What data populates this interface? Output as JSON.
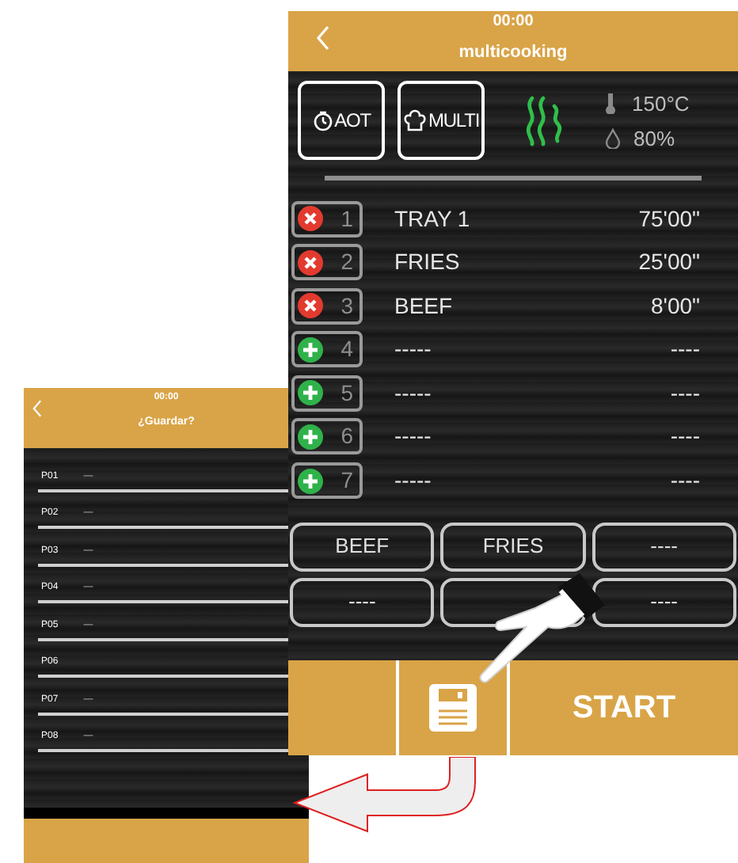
{
  "save_screen": {
    "time": "00:00",
    "title": "¿Guardar?",
    "slots": [
      {
        "label": "P01",
        "value": "—"
      },
      {
        "label": "P02",
        "value": "—"
      },
      {
        "label": "P03",
        "value": "—"
      },
      {
        "label": "P04",
        "value": "—"
      },
      {
        "label": "P05",
        "value": "—"
      },
      {
        "label": "P06"
      },
      {
        "label": "P07",
        "value": "—"
      },
      {
        "label": "P08",
        "value": "—"
      }
    ]
  },
  "cooking_screen": {
    "time": "00:00",
    "title": "multicooking",
    "mode_buttons": [
      {
        "kind": "aot",
        "label": "AOT"
      },
      {
        "kind": "multi",
        "label": "MULTI"
      }
    ],
    "temperature": "150°C",
    "humidity": "80%",
    "trays": [
      {
        "number": "1",
        "name": "TRAY 1",
        "time": "75'00\"",
        "kind": "remove"
      },
      {
        "number": "2",
        "name": "FRIES",
        "time": "25'00\"",
        "kind": "remove"
      },
      {
        "number": "3",
        "name": "BEEF",
        "time": "8'00\"",
        "kind": "remove"
      },
      {
        "number": "4",
        "name": "-----",
        "time": "----",
        "kind": "add"
      },
      {
        "number": "5",
        "name": "-----",
        "time": "----",
        "kind": "add"
      },
      {
        "number": "6",
        "name": "-----",
        "time": "----",
        "kind": "add"
      },
      {
        "number": "7",
        "name": "-----",
        "time": "----",
        "kind": "add"
      }
    ],
    "presets": [
      {
        "kind": "labeled",
        "label": "BEEF"
      },
      {
        "kind": "labeled",
        "label": "FRIES"
      },
      {
        "kind": "labeled",
        "label": "----"
      },
      {
        "kind": "labeled",
        "label": "----"
      },
      {
        "kind": "covered"
      },
      {
        "kind": "labeled",
        "label": "----"
      }
    ],
    "start_label": "START"
  }
}
